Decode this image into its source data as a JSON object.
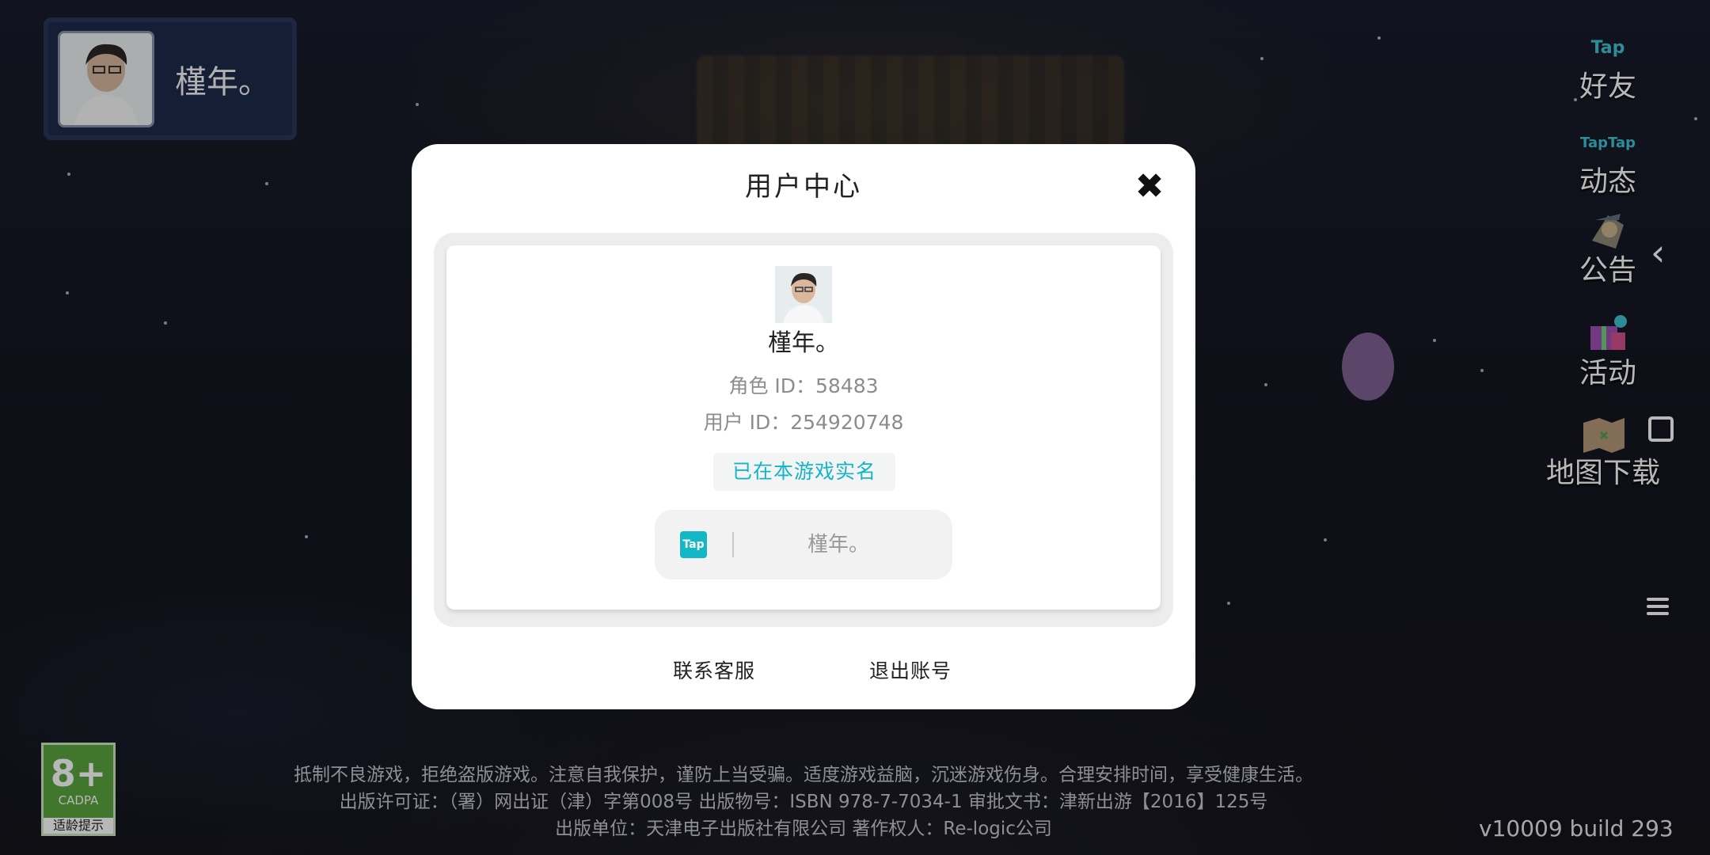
{
  "profile": {
    "name": "槿年。"
  },
  "side_menu": {
    "friends": {
      "icon": "tap-icon",
      "icon_text": "Tap",
      "label": "好友"
    },
    "moments": {
      "icon": "taptap-icon",
      "icon_text": "TapTap",
      "label": "动态"
    },
    "notice": {
      "icon": "scroll-npc-icon",
      "label": "公告"
    },
    "events": {
      "icon": "gift-icon",
      "label": "活动"
    },
    "map_download": {
      "icon": "map-icon",
      "label": "地图下载"
    }
  },
  "dialog": {
    "title": "用户中心",
    "user_name": "槿年。",
    "role_id": "角色 ID：58483",
    "user_id": "用户 ID：254920748",
    "verified_text": "已在本游戏实名",
    "tap_logo": "Tap",
    "tap_name": "槿年。",
    "contact_label": "联系客服",
    "logout_label": "退出账号"
  },
  "age_badge": {
    "age": "8+",
    "org": "CADPA",
    "tip": "适龄提示"
  },
  "footer": {
    "line1": "抵制不良游戏，拒绝盗版游戏。注意自我保护，谨防上当受骗。适度游戏益脑，沉迷游戏伤身。合理安排时间，享受健康生活。",
    "line2": "出版许可证：（署）网出证（津）字第008号 出版物号：ISBN 978-7-7034-1 审批文书：津新出游【2016】125号",
    "line3": "出版单位：天津电子出版社有限公司 著作权人：Re-logic公司"
  },
  "version": "v10009   build 293",
  "colors": {
    "accent": "#17b3c7",
    "badge_green": "#59a53f",
    "chip_bg": "#1d2a4a"
  }
}
